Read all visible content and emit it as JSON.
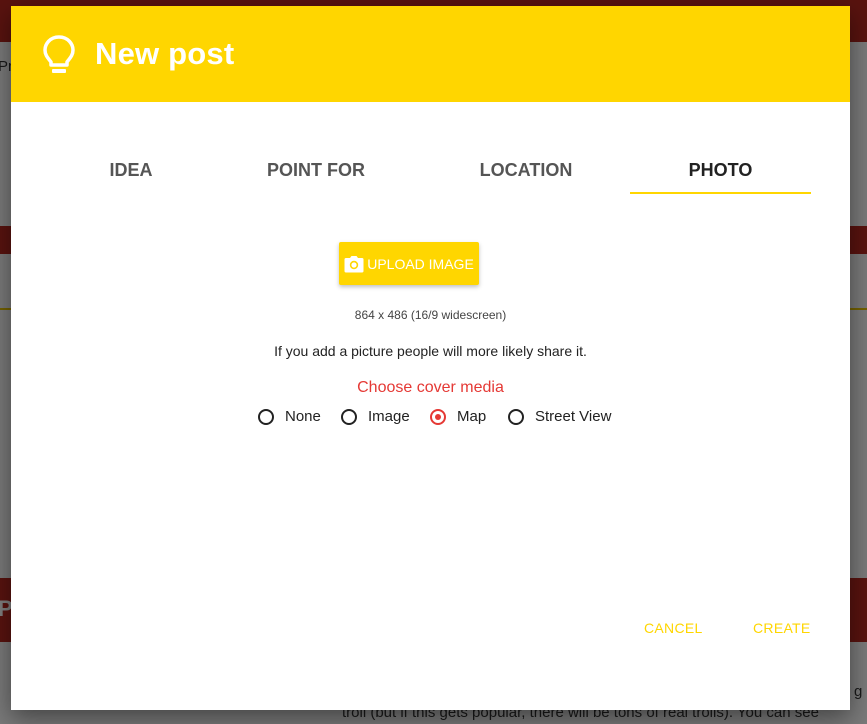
{
  "dialog": {
    "title": "New post",
    "icon": "lightbulb-icon"
  },
  "tabs": [
    {
      "label": "IDEA",
      "active": false
    },
    {
      "label": "POINT FOR",
      "active": false
    },
    {
      "label": "LOCATION",
      "active": false
    },
    {
      "label": "PHOTO",
      "active": true
    }
  ],
  "photo": {
    "upload_label": "UPLOAD IMAGE",
    "upload_icon": "camera-icon",
    "dimensions": "864 x 486 (16/9 widescreen)",
    "hint": "If you add a picture people will more likely share it.",
    "cover_label": "Choose cover media",
    "cover_options": [
      {
        "label": "None",
        "checked": false
      },
      {
        "label": "Image",
        "checked": false
      },
      {
        "label": "Map",
        "checked": true
      },
      {
        "label": "Street View",
        "checked": false
      }
    ]
  },
  "actions": {
    "cancel": "CANCEL",
    "create": "CREATE"
  },
  "background": {
    "snippet_1": "Pr",
    "snippet_2": "Pr",
    "snippet_3": "g",
    "snippet_4": "troll (but if this gets popular, there will be tons of real trolls). You can see"
  },
  "colors": {
    "accent": "#FFD600",
    "cover_label": "#e53935",
    "radio_checked": "#e53935"
  }
}
